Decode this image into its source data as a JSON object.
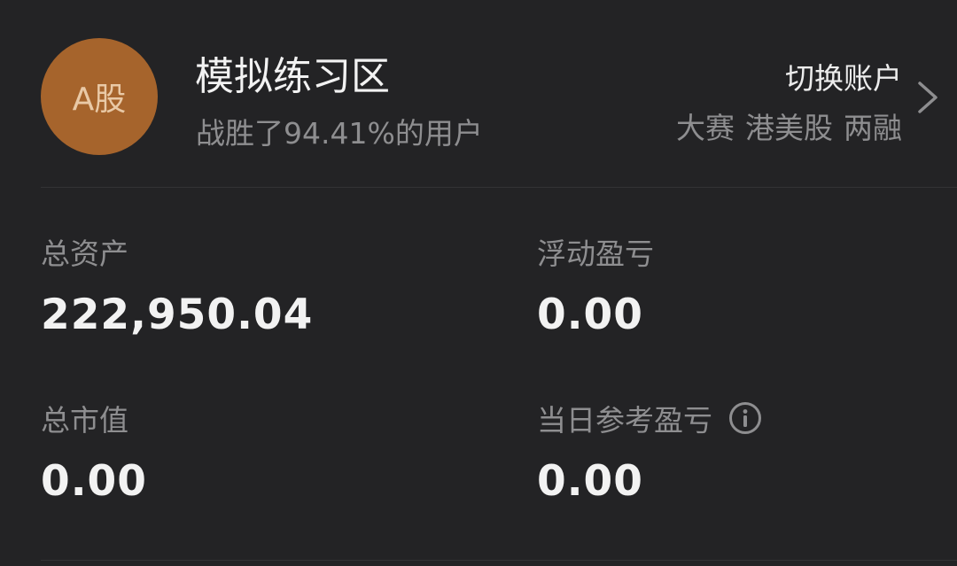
{
  "account": {
    "avatar_text": "A股",
    "title": "模拟练习区",
    "subtitle": "战胜了94.41%的用户",
    "switch_label": "切换账户",
    "switch_options": [
      "大赛",
      "港美股",
      "两融"
    ]
  },
  "stats": {
    "total_assets": {
      "label": "总资产",
      "value": "222,950.04"
    },
    "floating_pnl": {
      "label": "浮动盈亏",
      "value": "0.00"
    },
    "market_value": {
      "label": "总市值",
      "value": "0.00"
    },
    "daily_pnl": {
      "label": "当日参考盈亏",
      "value": "0.00"
    }
  },
  "icons": {
    "chevron": "chevron-right-icon",
    "info": "info-icon"
  },
  "colors": {
    "background": "#232325",
    "avatar": "#A6642C",
    "text_primary": "#F2F2F2",
    "text_secondary": "#8E8E90"
  }
}
